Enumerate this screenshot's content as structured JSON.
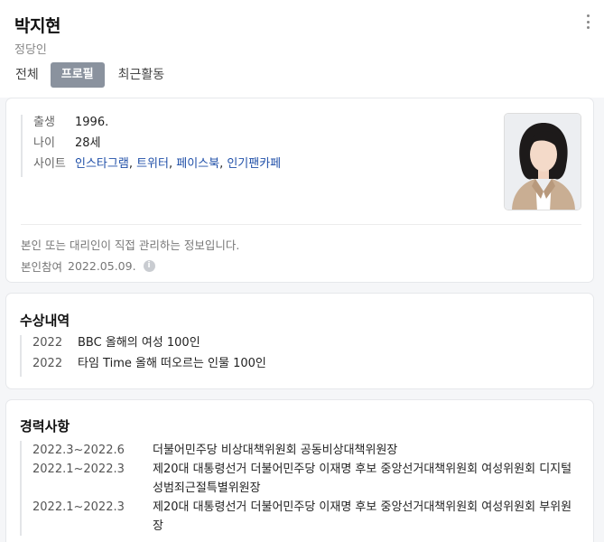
{
  "profile": {
    "name": "박지현",
    "role": "정당인"
  },
  "tabs": [
    {
      "label": "전체"
    },
    {
      "label": "프로필"
    },
    {
      "label": "최근활동"
    }
  ],
  "info": {
    "birth_label": "출생",
    "birth_value": "1996.",
    "age_label": "나이",
    "age_value": "28세",
    "site_label": "사이트",
    "sites": [
      "인스타그램",
      "트위터",
      "페이스북",
      "인기팬카페"
    ],
    "notice": "본인 또는 대리인이 직접 관리하는 정보입니다.",
    "participate_label": "본인참여",
    "participate_date": "2022.05.09.",
    "info_icon": "i"
  },
  "awards": {
    "title": "수상내역",
    "items": [
      {
        "year": "2022",
        "text": "BBC 올해의 여성 100인"
      },
      {
        "year": "2022",
        "text": "타임 Time 올해 떠오르는 인물 100인"
      }
    ]
  },
  "career": {
    "title": "경력사항",
    "items": [
      {
        "period": "2022.3~2022.6",
        "text": "더불어민주당 비상대책위원회 공동비상대책위원장"
      },
      {
        "period": "2022.1~2022.3",
        "text": "제20대 대통령선거 더불어민주당 이재명 후보 중앙선거대책위원회 여성위원회 디지털성범죄근절특별위원장"
      },
      {
        "period": "2022.1~2022.3",
        "text": "제20대 대통령선거 더불어민주당 이재명 후보 중앙선거대책위원회 여성위원회 부위원장"
      }
    ]
  },
  "colors": {
    "active_tab_bg": "#8a929e",
    "link": "#1f4fa8"
  }
}
